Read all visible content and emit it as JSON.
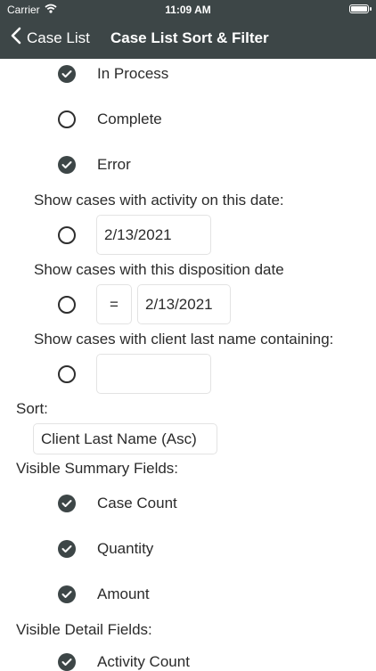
{
  "status_bar": {
    "carrier": "Carrier",
    "time": "11:09 AM"
  },
  "nav": {
    "back_label": "Case List",
    "title": "Case List Sort & Filter"
  },
  "status_filters": [
    {
      "label": "In Process",
      "checked": true
    },
    {
      "label": "Complete",
      "checked": false
    },
    {
      "label": "Error",
      "checked": true
    }
  ],
  "activity_date": {
    "heading": "Show cases with activity on this date:",
    "value": "2/13/2021"
  },
  "disposition_date": {
    "heading": "Show cases with this disposition date",
    "operator": "=",
    "value": "2/13/2021"
  },
  "client_name": {
    "heading": "Show cases with client last name containing:",
    "value": ""
  },
  "sort": {
    "heading": "Sort:",
    "value": "Client Last Name (Asc)"
  },
  "summary_fields": {
    "heading": "Visible Summary Fields:",
    "items": [
      {
        "label": "Case Count",
        "checked": true
      },
      {
        "label": "Quantity",
        "checked": true
      },
      {
        "label": "Amount",
        "checked": true
      }
    ]
  },
  "detail_fields": {
    "heading": "Visible Detail Fields:",
    "items": [
      {
        "label": "Activity Count",
        "checked": true
      }
    ]
  },
  "colors": {
    "header_bg": "#3d4647",
    "header_text": "#ffffff",
    "checked_fill": "#3d4647"
  }
}
